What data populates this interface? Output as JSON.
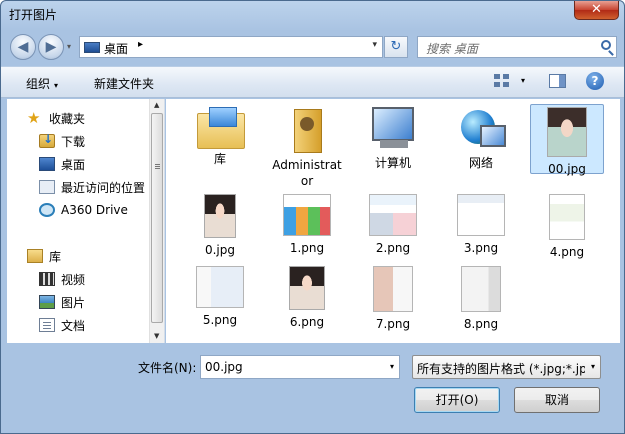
{
  "window": {
    "title": "打开图片",
    "close_glyph": "✕"
  },
  "nav": {
    "back_glyph": "◀",
    "forward_glyph": "▶",
    "dropdown_glyph": "▾"
  },
  "address": {
    "location": "桌面",
    "separator": "▸",
    "dropdown_glyph": "▾"
  },
  "refresh_glyph": "↻",
  "search": {
    "placeholder": "搜索 桌面"
  },
  "toolbar": {
    "organize": "组织",
    "new_folder": "新建文件夹",
    "caret": "▾",
    "help": "?"
  },
  "sidebar": {
    "items": [
      {
        "label": "收藏夹",
        "icon": "favorites-star-icon"
      },
      {
        "label": "下载",
        "icon": "downloads-folder-icon"
      },
      {
        "label": "桌面",
        "icon": "desktop-icon"
      },
      {
        "label": "最近访问的位置",
        "icon": "recent-places-icon"
      },
      {
        "label": "A360 Drive",
        "icon": "a360-drive-icon"
      },
      {
        "label": "库",
        "icon": "libraries-icon"
      },
      {
        "label": "视频",
        "icon": "videos-icon"
      },
      {
        "label": "图片",
        "icon": "pictures-icon"
      },
      {
        "label": "文档",
        "icon": "documents-icon"
      }
    ],
    "scroll_up": "▲",
    "scroll_down": "▼"
  },
  "files": [
    {
      "name": "库",
      "icon": "library-folder-icon"
    },
    {
      "name": "Administrator",
      "icon": "user-folder-icon"
    },
    {
      "name": "计算机",
      "icon": "computer-icon"
    },
    {
      "name": "网络",
      "icon": "network-icon"
    },
    {
      "name": "00.jpg",
      "icon": "portrait-thumbnail-icon",
      "selected": true
    },
    {
      "name": "0.jpg",
      "icon": "portrait-thumbnail-icon"
    },
    {
      "name": "1.png",
      "icon": "screenshot-thumbnail-icon"
    },
    {
      "name": "2.png",
      "icon": "screenshot-thumbnail-icon"
    },
    {
      "name": "3.png",
      "icon": "screenshot-thumbnail-icon"
    },
    {
      "name": "4.png",
      "icon": "screenshot-thumbnail-icon"
    },
    {
      "name": "5.png",
      "icon": "screenshot-thumbnail-icon"
    },
    {
      "name": "6.png",
      "icon": "portrait-thumbnail-icon"
    },
    {
      "name": "7.png",
      "icon": "screenshot-thumbnail-icon"
    },
    {
      "name": "8.png",
      "icon": "screenshot-thumbnail-icon"
    }
  ],
  "bottom": {
    "filename_label": "文件名(N):",
    "filename_value": "00.jpg",
    "filter_value": "所有支持的图片格式 (*.jpg;*.jp",
    "dropdown_glyph": "▾",
    "open_button": "打开(O)",
    "cancel_button": "取消"
  }
}
